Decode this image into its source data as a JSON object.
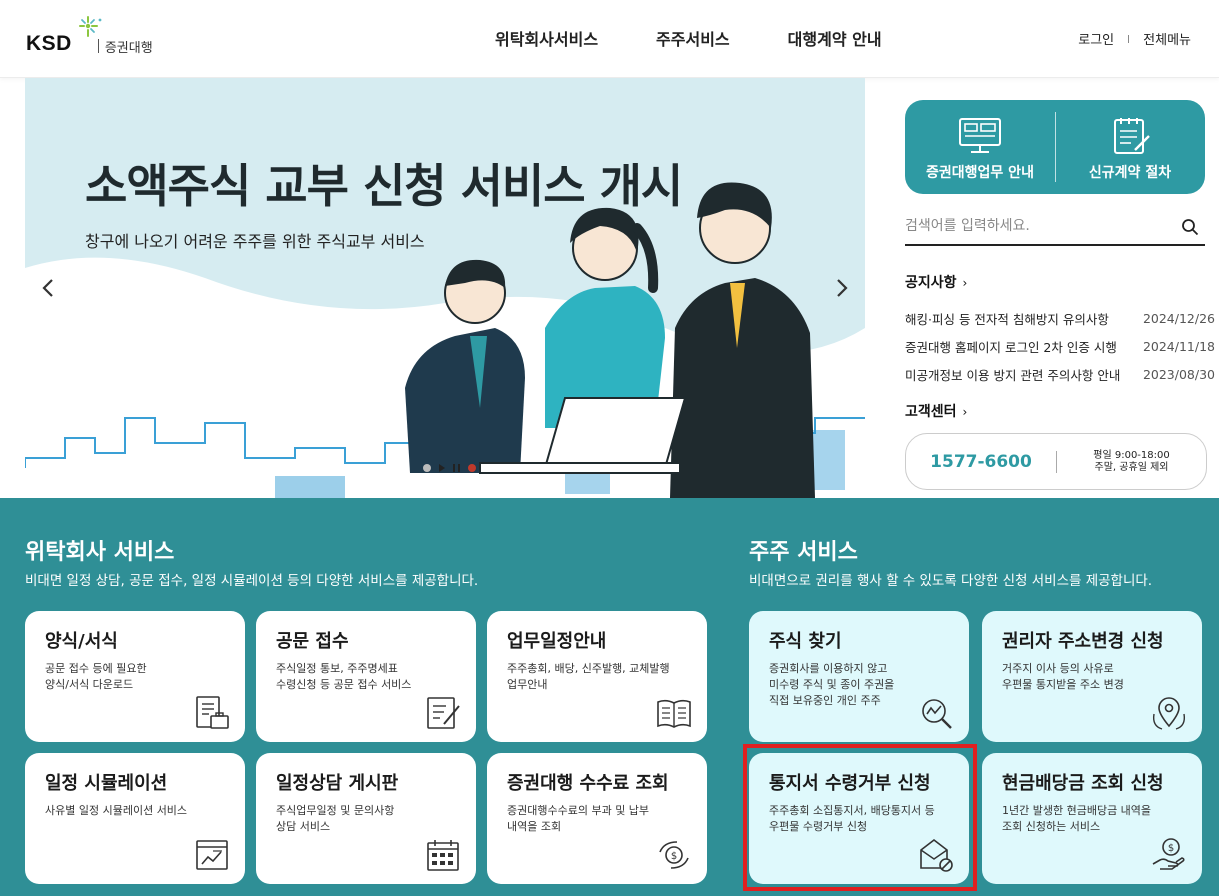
{
  "header": {
    "logo_text": "KSD",
    "logo_sub": "증권대행",
    "nav": [
      "위탁회사서비스",
      "주주서비스",
      "대행계약 안내"
    ],
    "login": "로그인",
    "all_menu": "전체메뉴"
  },
  "banner": {
    "title": "소액주식 교부 신청 서비스 개시",
    "subtitle": "창구에 나오기 어려운 주주를 위한 주식교부 서비스",
    "slide_count": 2,
    "active_slide": 2
  },
  "quick": {
    "items": [
      {
        "label": "증권대행업무 안내",
        "icon": "monitor-icon"
      },
      {
        "label": "신규계약 절차",
        "icon": "clipboard-icon"
      }
    ]
  },
  "search": {
    "placeholder": "검색어를 입력하세요."
  },
  "notice": {
    "title": "공지사항",
    "items": [
      {
        "text": "해킹·피싱 등 전자적 침해방지 유의사항",
        "date": "2024/12/26"
      },
      {
        "text": "증권대행 홈페이지 로그인 2차 인증 시행",
        "date": "2024/11/18"
      },
      {
        "text": "미공개정보 이용 방지 관련 주의사항 안내",
        "date": "2023/08/30"
      }
    ]
  },
  "customer_center": {
    "title": "고객센터",
    "phone": "1577-6600",
    "hours_1": "평일 9:00-18:00",
    "hours_2": "주말, 공휴일 제외"
  },
  "trust_services": {
    "title": "위탁회사 서비스",
    "desc": "비대면 일정 상담, 공문 접수, 일정 시뮬레이션 등의 다양한 서비스를 제공합니다.",
    "cards": [
      {
        "title": "양식/서식",
        "desc": "공문 접수 등에 필요한\n양식/서식 다운로드",
        "icon": "form-briefcase-icon"
      },
      {
        "title": "공문 접수",
        "desc": "주식일정 통보, 주주명세표\n수령신청 등 공문 접수 서비스",
        "icon": "document-pen-icon"
      },
      {
        "title": "업무일정안내",
        "desc": "주주총회, 배당, 신주발행, 교체발행\n업무안내",
        "icon": "open-book-icon"
      },
      {
        "title": "일정 시뮬레이션",
        "desc": "사유별 일정 시뮬레이션 서비스",
        "icon": "chart-window-icon"
      },
      {
        "title": "일정상담 게시판",
        "desc": "주식업무일정 및 문의사항\n상담 서비스",
        "icon": "calendar-icon"
      },
      {
        "title": "증권대행 수수료 조회",
        "desc": "증권대행수수료의 부과 및 납부\n내역을 조회",
        "icon": "coin-exchange-icon"
      }
    ]
  },
  "shareholder_services": {
    "title": "주주 서비스",
    "desc": "비대면으로 권리를 행사 할 수 있도록 다양한 신청 서비스를 제공합니다.",
    "cards": [
      {
        "title": "주식 찾기",
        "desc": "증권회사를 이용하지 않고\n미수령 주식 및 종이 주권을\n직접 보유중인 개인 주주",
        "icon": "chart-magnifier-icon"
      },
      {
        "title": "권리자 주소변경 신청",
        "desc": "거주지 이사 등의 사유로\n우편물 통지받을 주소 변경",
        "icon": "location-pin-icon"
      },
      {
        "title": "통지서 수령거부 신청",
        "desc": "주주총회 소집통지서, 배당통지서 등\n우편물 수령거부 신청",
        "icon": "envelope-block-icon"
      },
      {
        "title": "현금배당금 조회 신청",
        "desc": "1년간 발생한 현금배당금 내역을\n조회 신청하는 서비스",
        "icon": "coin-hand-icon"
      }
    ]
  },
  "colors": {
    "teal_section": "#2f8f96",
    "teal_quick": "#2e9aa3",
    "card_light": "#dff9fc",
    "highlight": "#e02020"
  }
}
